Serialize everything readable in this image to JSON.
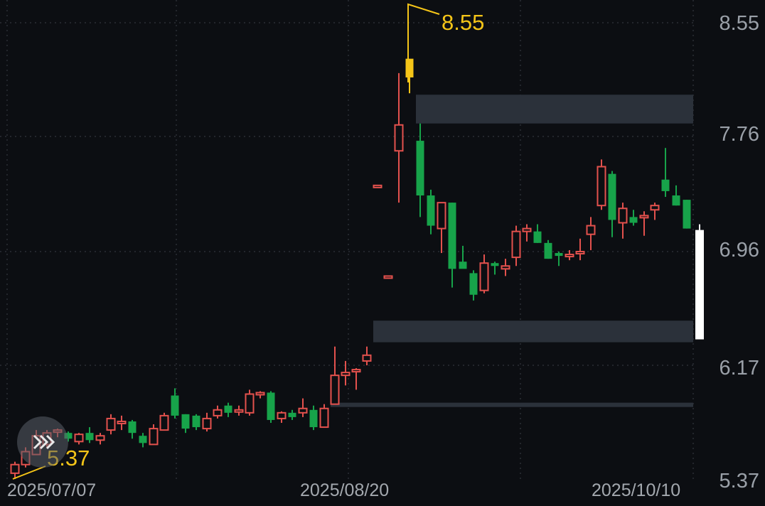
{
  "chart_data": {
    "type": "candlestick",
    "y_axis": {
      "ticks": [
        "8.55",
        "7.76",
        "6.96",
        "6.17",
        "5.37"
      ],
      "range": [
        5.37,
        8.55
      ],
      "grid": true
    },
    "x_axis": {
      "labels": [
        "2025/07/07",
        "2025/08/20",
        "2025/10/10"
      ]
    },
    "annotations": {
      "high_label": "8.55",
      "low_label": "5.37"
    },
    "colors": {
      "up": "#e3514d",
      "down": "#17a34a",
      "marker": "#f5c518",
      "zone": "#2b313a",
      "last_bar": "#ffffff"
    },
    "candles": [
      {
        "date": "2025/07/07",
        "o": 5.42,
        "h": 5.5,
        "l": 5.38,
        "c": 5.48
      },
      {
        "o": 5.48,
        "h": 5.6,
        "l": 5.46,
        "c": 5.57
      },
      {
        "o": 5.55,
        "h": 5.72,
        "l": 5.55,
        "c": 5.68
      },
      {
        "o": 5.62,
        "h": 5.72,
        "l": 5.6,
        "c": 5.7
      },
      {
        "o": 5.71,
        "h": 5.73,
        "l": 5.67,
        "c": 5.72
      },
      {
        "o": 5.7,
        "h": 5.71,
        "l": 5.64,
        "c": 5.66
      },
      {
        "o": 5.64,
        "h": 5.7,
        "l": 5.62,
        "c": 5.69
      },
      {
        "o": 5.7,
        "h": 5.74,
        "l": 5.63,
        "c": 5.65
      },
      {
        "o": 5.65,
        "h": 5.7,
        "l": 5.62,
        "c": 5.68
      },
      {
        "o": 5.72,
        "h": 5.83,
        "l": 5.69,
        "c": 5.8
      },
      {
        "o": 5.77,
        "h": 5.82,
        "l": 5.72,
        "c": 5.78
      },
      {
        "o": 5.78,
        "h": 5.79,
        "l": 5.66,
        "c": 5.7
      },
      {
        "o": 5.68,
        "h": 5.7,
        "l": 5.6,
        "c": 5.63
      },
      {
        "o": 5.62,
        "h": 5.76,
        "l": 5.62,
        "c": 5.73
      },
      {
        "o": 5.72,
        "h": 5.84,
        "l": 5.72,
        "c": 5.82
      },
      {
        "o": 5.96,
        "h": 6.01,
        "l": 5.8,
        "c": 5.82
      },
      {
        "o": 5.83,
        "h": 5.83,
        "l": 5.7,
        "c": 5.73
      },
      {
        "o": 5.82,
        "h": 5.83,
        "l": 5.72,
        "c": 5.74
      },
      {
        "o": 5.73,
        "h": 5.84,
        "l": 5.71,
        "c": 5.8
      },
      {
        "o": 5.82,
        "h": 5.89,
        "l": 5.8,
        "c": 5.86
      },
      {
        "o": 5.89,
        "h": 5.91,
        "l": 5.81,
        "c": 5.84
      },
      {
        "o": 5.85,
        "h": 5.89,
        "l": 5.82,
        "c": 5.86
      },
      {
        "o": 5.84,
        "h": 6.0,
        "l": 5.82,
        "c": 5.97
      },
      {
        "o": 5.97,
        "h": 5.99,
        "l": 5.94,
        "c": 5.98
      },
      {
        "o": 5.98,
        "h": 5.99,
        "l": 5.77,
        "c": 5.79
      },
      {
        "o": 5.8,
        "h": 5.85,
        "l": 5.77,
        "c": 5.84
      },
      {
        "o": 5.84,
        "h": 5.86,
        "l": 5.79,
        "c": 5.81
      },
      {
        "o": 5.84,
        "h": 5.94,
        "l": 5.81,
        "c": 5.87
      },
      {
        "o": 5.86,
        "h": 5.89,
        "l": 5.72,
        "c": 5.74
      },
      {
        "o": 5.74,
        "h": 5.9,
        "l": 5.74,
        "c": 5.87
      },
      {
        "o": 5.9,
        "h": 6.3,
        "l": 5.9,
        "c": 6.1
      },
      {
        "o": 6.1,
        "h": 6.2,
        "l": 6.03,
        "c": 6.12
      },
      {
        "o": 6.13,
        "h": 6.15,
        "l": 6.0,
        "c": 6.14
      },
      {
        "o": 6.2,
        "h": 6.3,
        "l": 6.17,
        "c": 6.24
      },
      {
        "o": 7.41,
        "h": 7.41,
        "l": 7.41,
        "c": 7.42
      },
      {
        "o": 6.78,
        "h": 6.78,
        "l": 6.78,
        "c": 6.79
      },
      {
        "o": 7.66,
        "h": 8.2,
        "l": 7.3,
        "c": 7.84
      },
      {
        "date": "high",
        "o": 8.17,
        "h": 8.17,
        "l": 8.06,
        "c": 8.3,
        "marker": true
      },
      {
        "o": 7.73,
        "h": 7.85,
        "l": 7.2,
        "c": 7.35
      },
      {
        "o": 7.35,
        "h": 7.39,
        "l": 7.08,
        "c": 7.14
      },
      {
        "o": 7.12,
        "h": 7.2,
        "l": 6.95,
        "c": 7.3
      },
      {
        "o": 7.3,
        "h": 7.3,
        "l": 6.71,
        "c": 6.84
      },
      {
        "o": 6.89,
        "h": 7.0,
        "l": 6.86,
        "c": 6.84
      },
      {
        "o": 6.81,
        "h": 6.83,
        "l": 6.62,
        "c": 6.66
      },
      {
        "o": 6.69,
        "h": 6.94,
        "l": 6.67,
        "c": 6.88
      },
      {
        "o": 6.88,
        "h": 6.89,
        "l": 6.8,
        "c": 6.86
      },
      {
        "o": 6.84,
        "h": 6.91,
        "l": 6.79,
        "c": 6.86
      },
      {
        "o": 6.92,
        "h": 7.14,
        "l": 6.86,
        "c": 7.1
      },
      {
        "o": 7.1,
        "h": 7.15,
        "l": 7.03,
        "c": 7.12
      },
      {
        "o": 7.1,
        "h": 7.15,
        "l": 7.02,
        "c": 7.02
      },
      {
        "o": 7.02,
        "h": 7.04,
        "l": 6.91,
        "c": 6.91
      },
      {
        "o": 6.95,
        "h": 6.96,
        "l": 6.86,
        "c": 6.93
      },
      {
        "o": 6.93,
        "h": 6.97,
        "l": 6.9,
        "c": 6.94
      },
      {
        "o": 6.96,
        "h": 7.05,
        "l": 6.9,
        "c": 6.96
      },
      {
        "o": 7.08,
        "h": 7.2,
        "l": 6.97,
        "c": 7.14
      },
      {
        "o": 7.28,
        "h": 7.6,
        "l": 7.25,
        "c": 7.55
      },
      {
        "o": 7.5,
        "h": 7.52,
        "l": 7.06,
        "c": 7.18
      },
      {
        "o": 7.16,
        "h": 7.3,
        "l": 7.05,
        "c": 7.26
      },
      {
        "o": 7.2,
        "h": 7.25,
        "l": 7.14,
        "c": 7.16
      },
      {
        "o": 7.2,
        "h": 7.24,
        "l": 7.07,
        "c": 7.21
      },
      {
        "o": 7.25,
        "h": 7.3,
        "l": 7.18,
        "c": 7.28
      },
      {
        "o": 7.46,
        "h": 7.68,
        "l": 7.34,
        "c": 7.38
      },
      {
        "o": 7.35,
        "h": 7.42,
        "l": 7.28,
        "c": 7.28
      },
      {
        "date": "2025/10/10",
        "o": 7.32,
        "h": 7.32,
        "l": 7.12,
        "c": 7.12
      }
    ],
    "zones": [
      {
        "from": 7.85,
        "to": 8.05
      },
      {
        "from": 6.33,
        "to": 6.48
      },
      {
        "from": 5.88,
        "to": 5.91
      }
    ],
    "last_bar": {
      "from": 6.35,
      "to": 7.11
    }
  }
}
